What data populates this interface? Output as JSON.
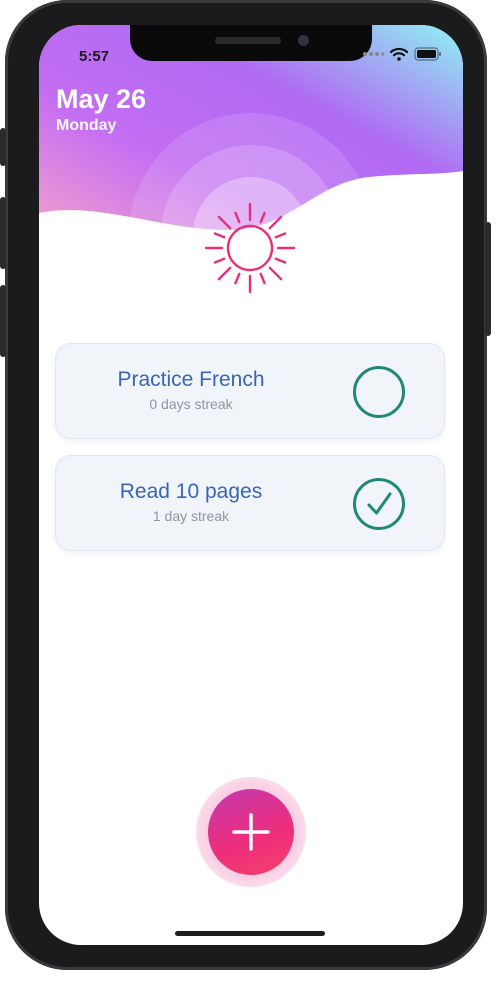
{
  "status_bar": {
    "time": "5:57",
    "icons": [
      "signal-icon",
      "wifi-icon",
      "battery-icon"
    ]
  },
  "header": {
    "date": "May 26",
    "weekday": "Monday",
    "gradient_colors": [
      "#f9a8c9",
      "#b65cf0",
      "#8fb8f5",
      "#8ff2f3"
    ],
    "icon": "sun-icon",
    "icon_color": "#e6317a"
  },
  "habits": [
    {
      "title": "Practice French",
      "subtitle": "0 days streak",
      "completed": false
    },
    {
      "title": "Read 10 pages",
      "subtitle": "1 day streak",
      "completed": true
    }
  ],
  "colors": {
    "card_title": "#3a66b5",
    "check": "#1f8a73",
    "fab": "#ef2d7a"
  },
  "fab": {
    "icon": "plus-icon",
    "action": "add habit"
  }
}
